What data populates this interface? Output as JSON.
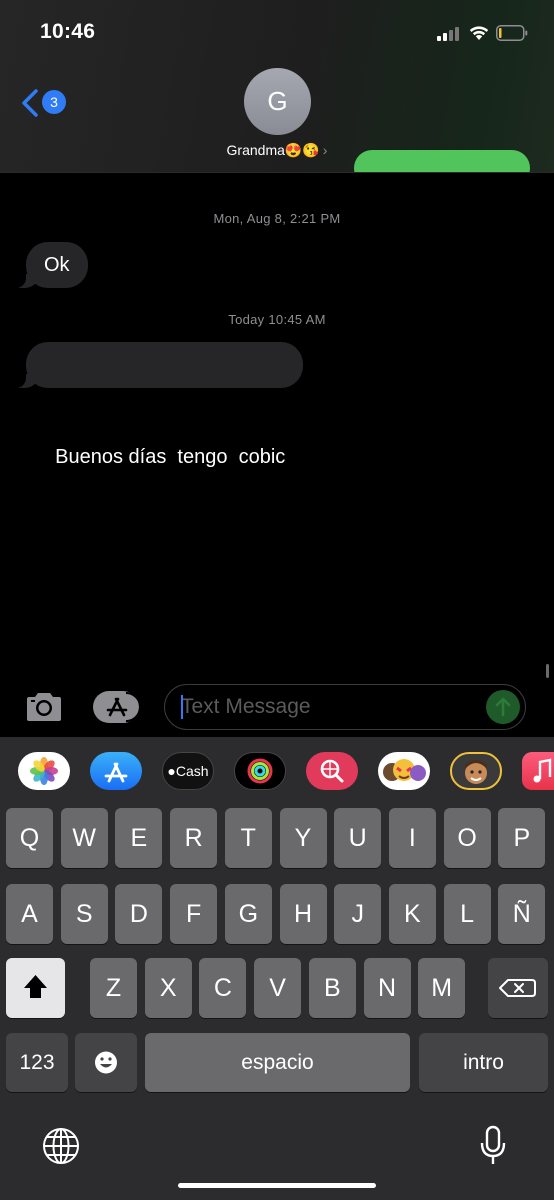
{
  "status_bar": {
    "time": "10:46"
  },
  "header": {
    "back_badge_count": "3",
    "avatar_initial": "G",
    "contact_name": "Grandma😍😘",
    "contact_chevron": "›"
  },
  "messages": [
    {
      "timestamp": "Mon, Aug 8, 2:21 PM",
      "text": "Ok"
    },
    {
      "timestamp": "Today 10:45 AM",
      "text": "Buenos días  tengo  cobic"
    }
  ],
  "compose": {
    "placeholder": "Text Message"
  },
  "app_strip": {
    "items": [
      {
        "name": "photos-app-icon"
      },
      {
        "name": "app-store-icon"
      },
      {
        "name": "apple-cash-icon",
        "label": "Cash"
      },
      {
        "name": "activity-app-icon"
      },
      {
        "name": "image-search-icon"
      },
      {
        "name": "memoji-stickers-icon"
      },
      {
        "name": "memoji-icon"
      },
      {
        "name": "music-app-icon"
      }
    ]
  },
  "keyboard": {
    "row1": [
      "Q",
      "W",
      "E",
      "R",
      "T",
      "Y",
      "U",
      "I",
      "O",
      "P"
    ],
    "row2": [
      "A",
      "S",
      "D",
      "F",
      "G",
      "H",
      "J",
      "K",
      "L",
      "Ñ"
    ],
    "row3": [
      "Z",
      "X",
      "C",
      "V",
      "B",
      "N",
      "M"
    ],
    "numbers_key": "123",
    "space_key": "espacio",
    "return_key": "intro"
  },
  "colors": {
    "accent": "#2f7cf6",
    "sent_bubble": "#52c45c",
    "received_bubble": "#262628",
    "keyboard_bg": "#2c2c2e",
    "key": "#6a6a6c"
  }
}
